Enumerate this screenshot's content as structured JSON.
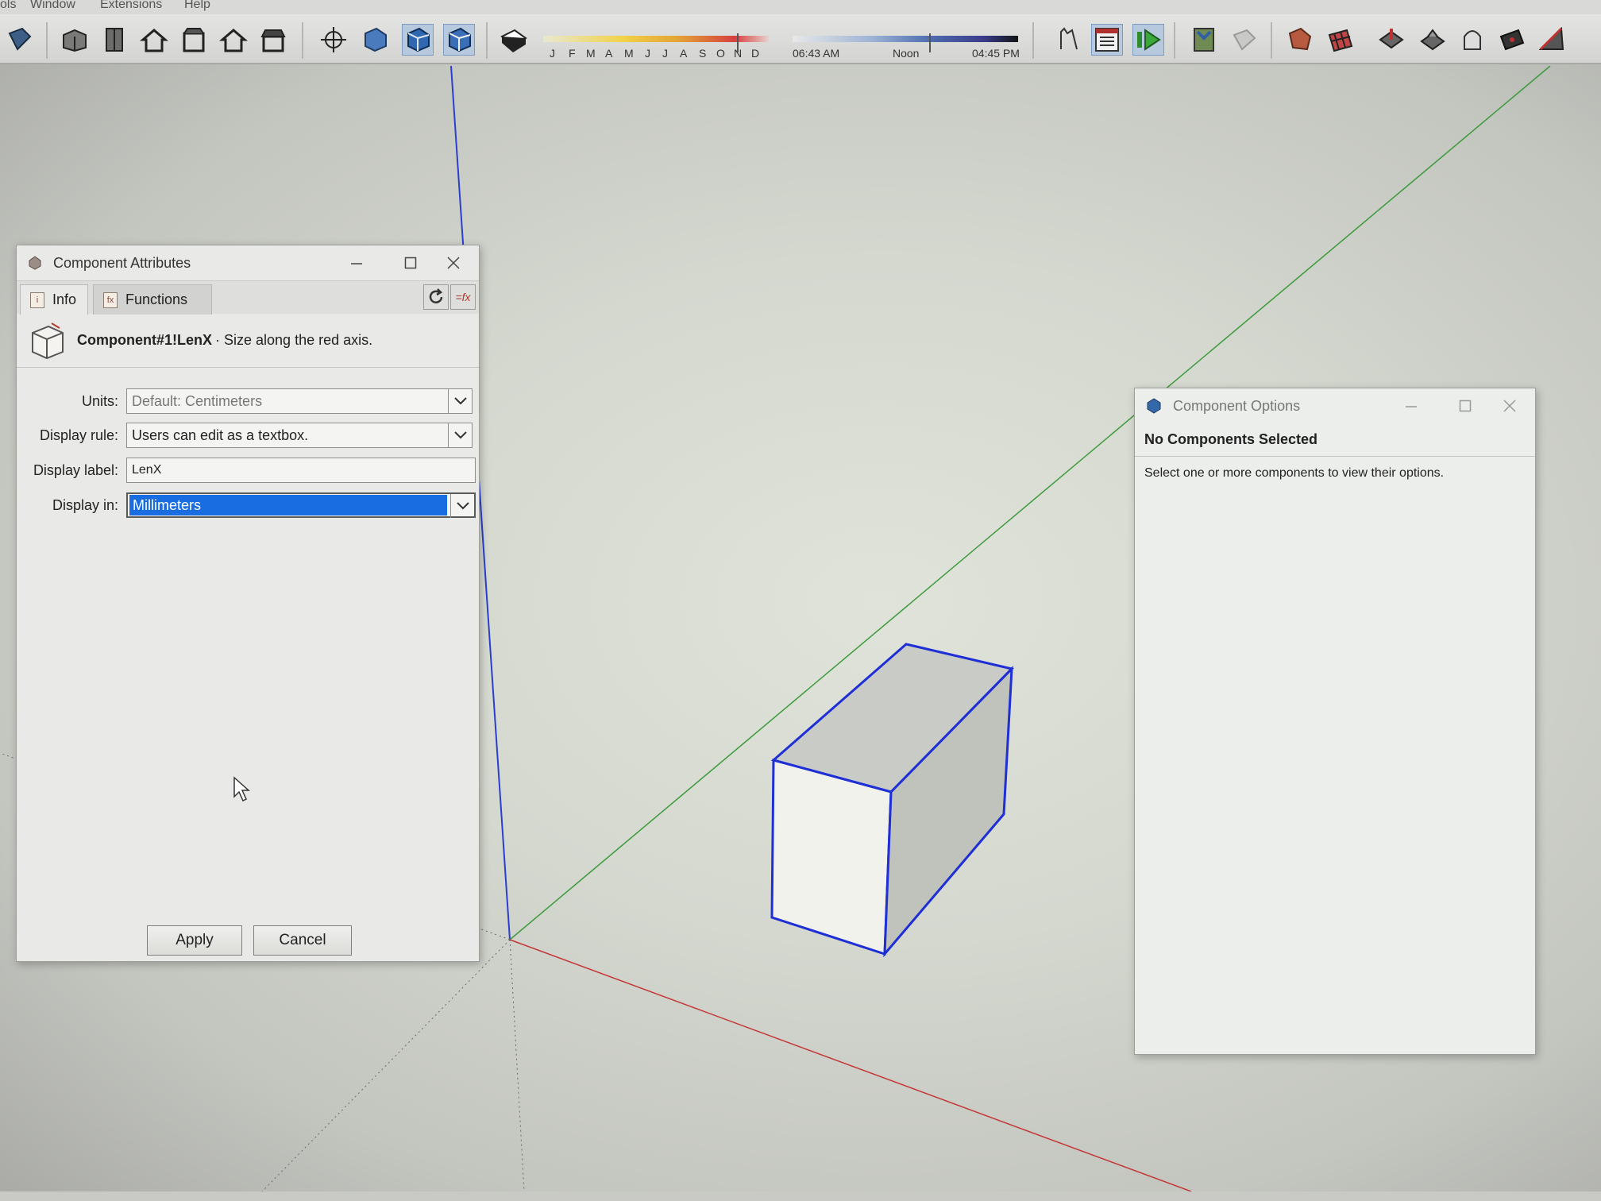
{
  "menubar": {
    "items": [
      "ols",
      "Window",
      "Extensions",
      "Help"
    ]
  },
  "toolbar": {
    "shadow_months": [
      "J",
      "F",
      "M",
      "A",
      "M",
      "J",
      "J",
      "A",
      "S",
      "O",
      "N",
      "D"
    ],
    "shadow_time_start": "06:43 AM",
    "shadow_time_mid": "Noon",
    "shadow_time_end": "04:45 PM"
  },
  "component_attributes": {
    "title": "Component Attributes",
    "tabs": [
      {
        "label": "Info",
        "selected": true
      },
      {
        "label": "Functions",
        "selected": false
      }
    ],
    "header_name": "Component#1!LenX",
    "header_desc": " · Size along the red axis.",
    "fields": {
      "units": {
        "label": "Units:",
        "value": "Default: Centimeters"
      },
      "display_rule": {
        "label": "Display rule:",
        "value": "Users can edit as a textbox."
      },
      "display_label": {
        "label": "Display label:",
        "value": "LenX"
      },
      "display_in": {
        "label": "Display in:",
        "value": "Millimeters"
      }
    },
    "apply_label": "Apply",
    "cancel_label": "Cancel"
  },
  "component_options": {
    "title": "Component Options",
    "heading": "No Components Selected",
    "message": "Select one or more components to view their options."
  },
  "colors": {
    "selection_blue": "#1a6de0",
    "edge_blue": "#1f2fd6",
    "axis_red": "#c43838",
    "axis_green": "#3c9a3c",
    "axis_blue": "#2a3fd0"
  }
}
